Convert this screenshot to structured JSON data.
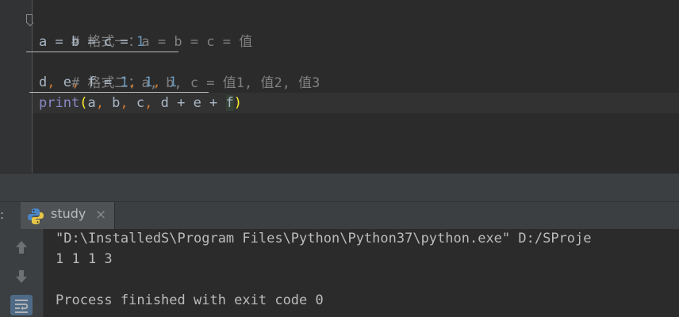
{
  "editor": {
    "line1_comment": "# 格式一：a = b = c = 值",
    "line2": {
      "a": "a",
      "eq1": " = ",
      "b": "b",
      "eq2": " = ",
      "c": "c",
      "eq3": " = ",
      "num": "1"
    },
    "line3_comment": "# 格式二：a, b, c = 值1, 值2, 值3",
    "line4": {
      "d": "d",
      "comma1": ",",
      "e": " e",
      "comma2": ",",
      "f": " f",
      "eq": " = ",
      "n1": "1",
      "comma3": ",",
      "n2": " 1",
      "comma4": ",",
      "n3": " 1"
    },
    "line5": {
      "print": "print",
      "open": "(",
      "a": "a",
      "c1": ",",
      "b": " b",
      "c2": ",",
      "c": " c",
      "c3": ",",
      "expr": " d + e + ",
      "f": "f",
      "close": ")"
    }
  },
  "run_panel": {
    "edge_label": ":",
    "tab_title": "study",
    "tab_close": "×"
  },
  "console": {
    "line1": "\"D:\\InstalledS\\Program Files\\Python\\Python37\\python.exe\" D:/SProje",
    "line2": "1 1 1 3",
    "line3": "Process finished with exit code 0"
  },
  "icons": {
    "fold": "fold-marker-icon",
    "python": "python-icon",
    "up": "arrow-up-icon",
    "down": "arrow-down-icon",
    "wrap": "soft-wrap-icon"
  },
  "colors": {
    "background": "#2B2B2B",
    "comment": "#808080",
    "number": "#6897BB",
    "keyword_comma": "#CC7832",
    "builtin": "#8888C6",
    "paren_match": "#FFEF28"
  }
}
